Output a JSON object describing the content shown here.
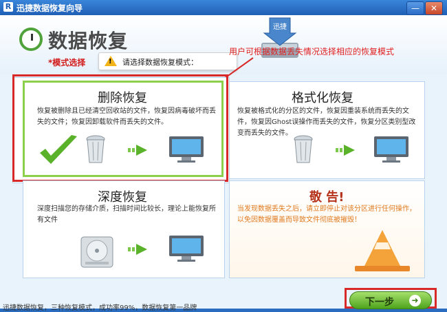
{
  "window": {
    "title": "迅捷数据恢复向导",
    "app_icon_letter": "R",
    "minimize": "—",
    "close": "✕"
  },
  "header": {
    "title": "数据恢复",
    "mode_select": "*模式选择",
    "tip": "请选择数据恢复模式：",
    "annotation": "用户可根据数据丢失情况选择相应的恢复模式",
    "disk_label": "迅捷"
  },
  "cards": {
    "delete": {
      "title": "删除恢复",
      "desc": "恢复被删除且已经清空回收站的文件，恢复因病毒破坏而丢失的文件；恢复因卸载软件而丢失的文件。"
    },
    "format": {
      "title": "格式化恢复",
      "desc": "恢复被格式化的分区的文件，恢复因重装系统而丢失的文件，恢复因Ghost误操作而丢失的文件，恢复分区类别型改变而丢失的文件。"
    },
    "deep": {
      "title": "深度恢复",
      "desc": "深度扫描您的存储介质，扫描时间比较长，理论上能恢复所有文件"
    },
    "warning": {
      "title": "敬 告!",
      "desc": "当发现数据丢失之后，请立即停止对该分区进行任何操作，以免因数据覆盖而导致文件彻底被摧毁！"
    }
  },
  "footer": {
    "text": "迅捷数据恢复，三种恢复模式，成功率99%，数据恢复第一品牌",
    "next_label": "下一步",
    "next_icon": "➜"
  },
  "colors": {
    "title_bar": "#1f5fb6",
    "highlight_red": "#d92828",
    "selected_green": "#8bcf4a",
    "next_green": "#4ea31c"
  }
}
